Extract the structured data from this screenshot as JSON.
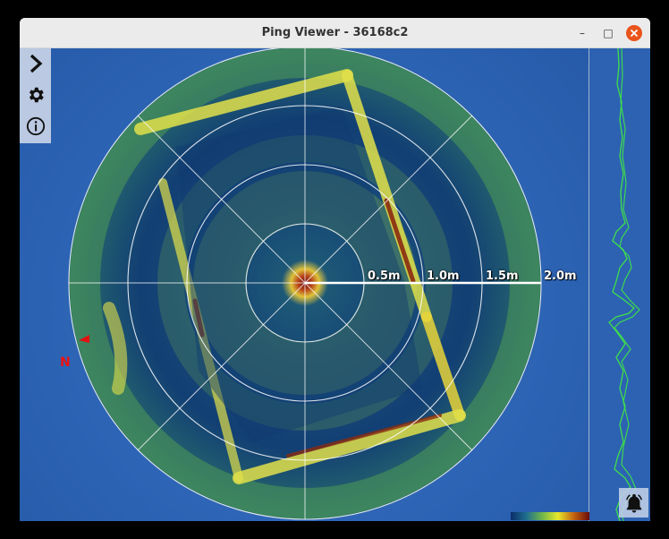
{
  "window": {
    "title": "Ping Viewer - 36168c2",
    "controls": {
      "minimize": "–",
      "maximize": "□"
    }
  },
  "sidebar": {
    "items": [
      {
        "icon": "chevron-right-icon"
      },
      {
        "icon": "gear-icon"
      },
      {
        "icon": "info-icon"
      }
    ]
  },
  "sonar": {
    "range_labels": [
      "0.5m",
      "1.0m",
      "1.5m",
      "2.0m"
    ],
    "north_label": "N",
    "colors": {
      "background": "#2f66b7",
      "low": "#0b2d6b",
      "mid": "#e8e82a",
      "high": "#6b0b0b",
      "profile": "#3ee04a",
      "north": "#e11111"
    }
  },
  "profile_panel": {
    "icon": "bell-icon"
  }
}
